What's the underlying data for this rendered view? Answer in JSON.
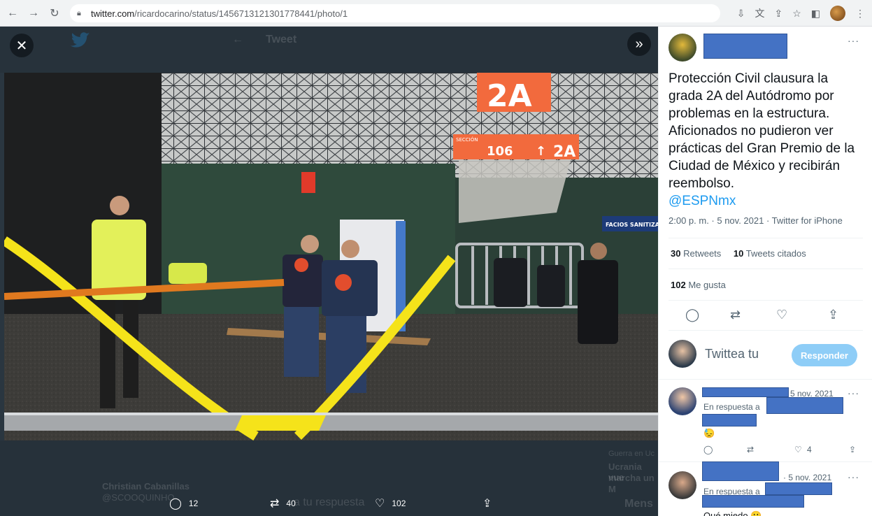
{
  "browser": {
    "url_host": "twitter.com",
    "url_path": "/ricardocarino/status/1456713121301778441/photo/1",
    "icons": [
      "back-icon",
      "forward-icon",
      "reload-icon",
      "lock-icon",
      "install-icon",
      "translate-icon",
      "share-icon",
      "star-icon",
      "sidepanel-icon",
      "profile-avatar",
      "menu-icon"
    ]
  },
  "viewer": {
    "ghost_title": "Tweet",
    "ghost_user": "Christian Cabanillas",
    "ghost_handle": "@SCOOQUINHO",
    "ghost_reply": "a tu respuesta",
    "ghost_side_1": "Ucrania vue",
    "ghost_side_2": "marcha un",
    "ghost_side_3": "M",
    "ghost_side_label": "Guerra en Uc",
    "ghost_side_4": "Mens",
    "replies": "12",
    "retweets": "40",
    "likes": "102"
  },
  "photo": {
    "sign_section_label": "SECCIÓN",
    "sign_section_number": "106",
    "sign_zone": "2A",
    "banner": "FACIOS SANITIZADOS"
  },
  "tweet": {
    "text": "Protección Civil clausura la grada 2A del Autódromo por problemas en la estructura. Aficionados no pudieron ver prácticas del Gran Premio de la Ciudad de México y recibirán reembolso.",
    "mention": "@ESPNmx",
    "meta": "2:00 p. m. · 5 nov. 2021 · Twitter for iPhone",
    "retweets_count": "30",
    "retweets_label": "Retweets",
    "quotes_count": "10",
    "quotes_label": "Tweets citados",
    "likes_count": "102",
    "likes_label": "Me gusta"
  },
  "reply": {
    "placeholder": "Twittea tu",
    "button": "Responder"
  },
  "comments": [
    {
      "date": "5 nov. 2021",
      "in_reply_prefix": "En respuesta a",
      "text": "😓",
      "like_count": "4"
    },
    {
      "date": "· 5 nov. 2021",
      "in_reply_prefix": "En respuesta a",
      "text": "Qué miedo 😬"
    }
  ],
  "colors": {
    "accent": "#1d9bf0",
    "redaction": "#4472c4",
    "caution_tape": "#f5e31a",
    "sign_orange": "#f26a3d"
  }
}
